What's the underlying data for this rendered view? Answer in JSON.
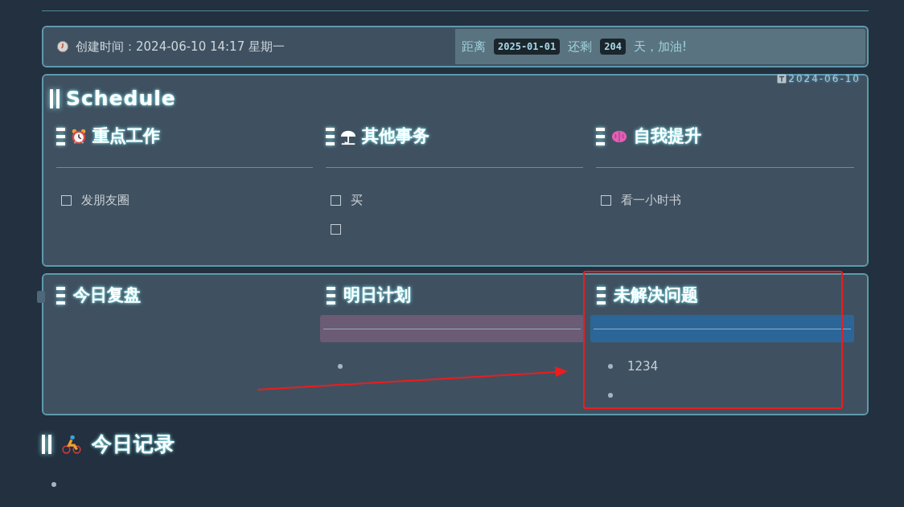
{
  "info_bar": {
    "created": "创建时间：2024-06-10 14:17 星期一",
    "countdown": {
      "prefix": "距离",
      "target": "2025-01-01",
      "middle": "还剩",
      "days": "204",
      "suffix": "天，加油!"
    }
  },
  "schedule": {
    "date_tag": "2024-06-10",
    "title": "Schedule",
    "columns": [
      {
        "title": "重点工作",
        "tasks": [
          {
            "text": "发朋友圈",
            "checked": false
          }
        ]
      },
      {
        "title": "其他事务",
        "tasks": [
          {
            "text": "买",
            "checked": false
          },
          {
            "checked": false
          }
        ]
      },
      {
        "title": "自我提升",
        "tasks": [
          {
            "text": "看一小时书",
            "checked": false
          }
        ]
      }
    ]
  },
  "review": {
    "columns": [
      {
        "title": "今日复盘"
      },
      {
        "title": "明日计划",
        "color": "#6b5b75",
        "items": [
          {
            "kind": "bullet"
          }
        ]
      },
      {
        "title": "未解决问题",
        "color": "#2c6699",
        "items": [
          {
            "kind": "bullet",
            "text": "1234"
          },
          {
            "kind": "bullet"
          }
        ]
      }
    ]
  },
  "log": {
    "title": "今日记录",
    "items": [
      {
        "kind": "bullet"
      }
    ]
  },
  "annotations": {
    "arrow": true,
    "frame": true
  }
}
